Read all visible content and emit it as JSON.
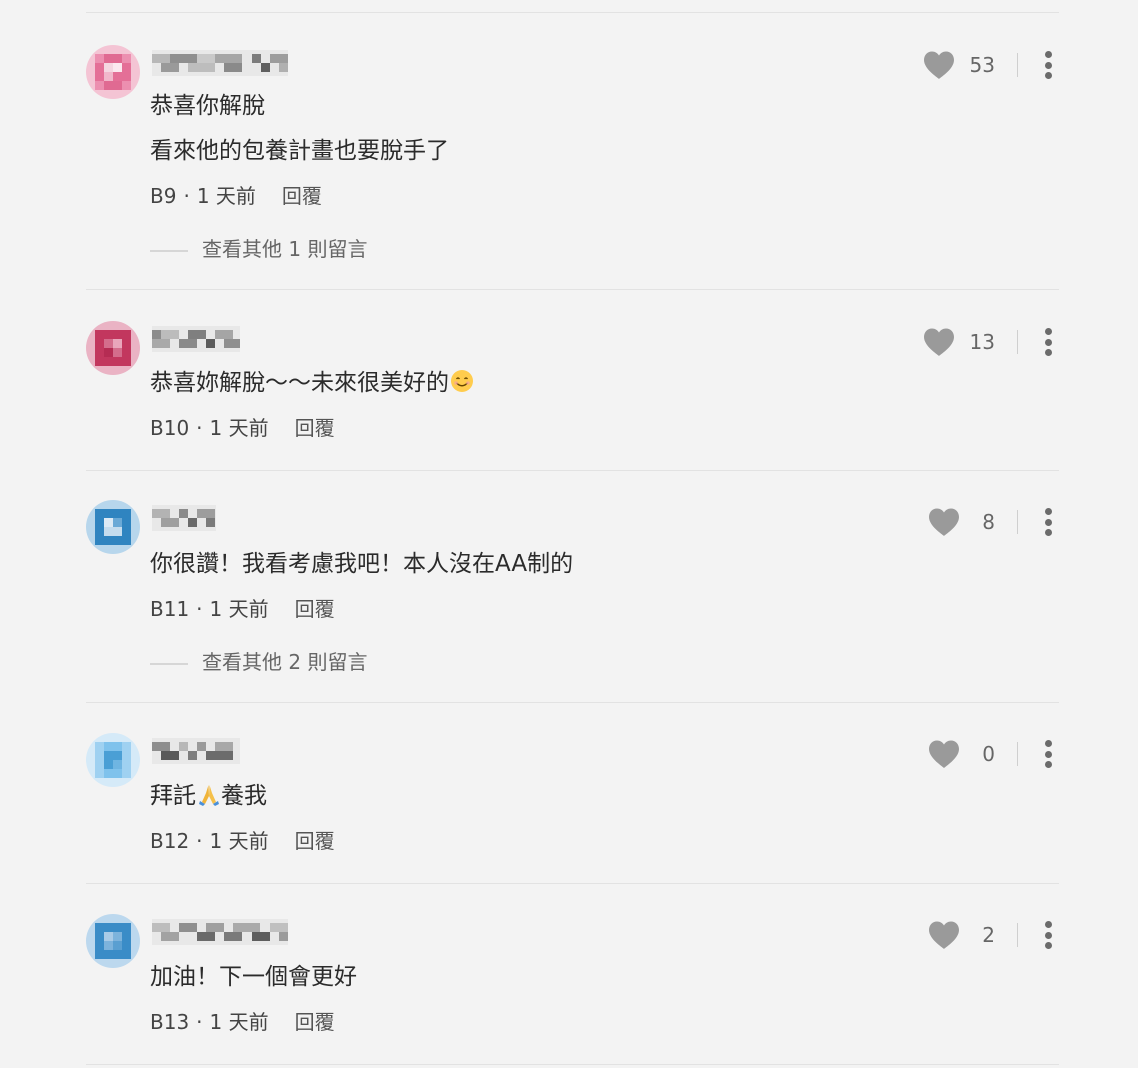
{
  "comments": [
    {
      "text_lines": [
        "恭喜你解脫",
        "看來他的包養計畫也要脫手了"
      ],
      "floor": "B9",
      "time": "1 天前",
      "reply_label": "回覆",
      "likes": "53",
      "more_replies": "查看其他 1 則留言",
      "avatar_color": "#e06a92"
    },
    {
      "text_lines": [
        "恭喜妳解脫～～未來很美好的"
      ],
      "emoji": "smiling-face",
      "floor": "B10",
      "time": "1 天前",
      "reply_label": "回覆",
      "likes": "13",
      "avatar_color": "#c2375e"
    },
    {
      "text_lines": [
        "你很讚！我看考慮我吧！本人沒在AA制的"
      ],
      "floor": "B11",
      "time": "1 天前",
      "reply_label": "回覆",
      "likes": "8",
      "more_replies": "查看其他 2 則留言",
      "avatar_color": "#2f84c0"
    },
    {
      "text_lines": [
        "拜託",
        "養我"
      ],
      "emoji": "folded-hands",
      "floor": "B12",
      "time": "1 天前",
      "reply_label": "回覆",
      "likes": "0",
      "avatar_color": "#7fc2ec"
    },
    {
      "text_lines": [
        "加油！下一個會更好"
      ],
      "floor": "B13",
      "time": "1 天前",
      "reply_label": "回覆",
      "likes": "2",
      "avatar_color": "#3a8cc7"
    }
  ],
  "colors": {
    "background": "#f3f3f3",
    "heart": "#9a9a9a",
    "text": "#2b2b2b",
    "meta": "#555555"
  }
}
